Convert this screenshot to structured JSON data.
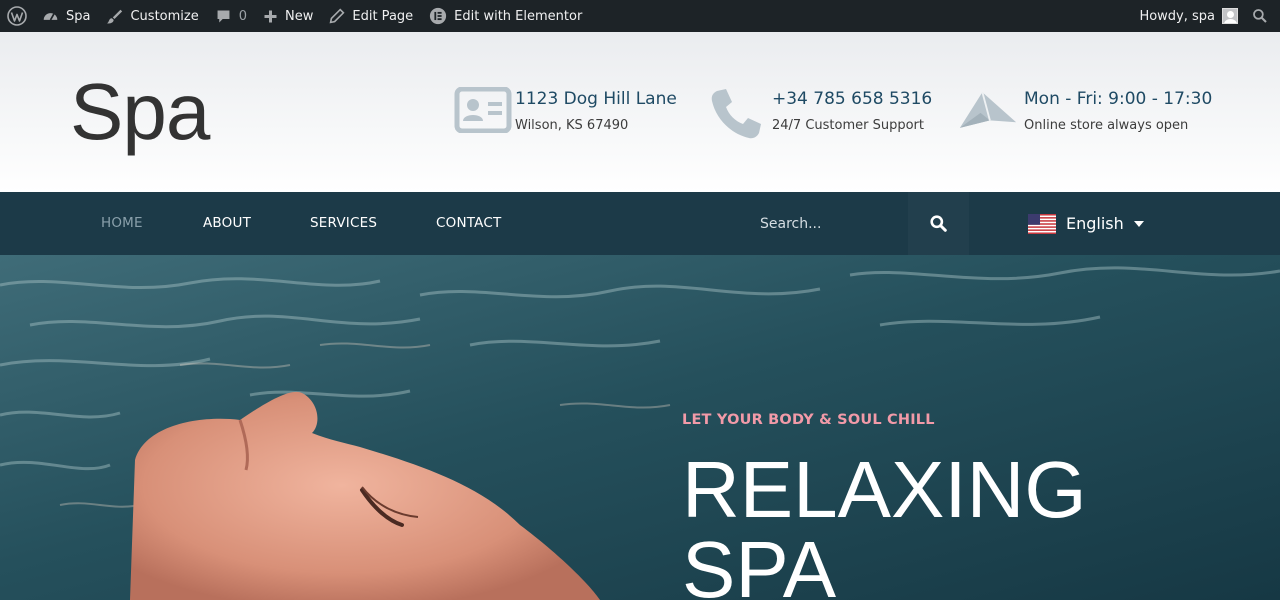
{
  "admin_bar": {
    "site_name": "Spa",
    "customize": "Customize",
    "comments_count": "0",
    "new": "New",
    "edit_page": "Edit Page",
    "edit_elementor": "Edit with Elementor",
    "howdy": "Howdy, spa"
  },
  "header": {
    "site_title": "Spa",
    "address": {
      "line1": "1123 Dog Hill Lane",
      "line2": "Wilson, KS 67490",
      "icon": "id-card-icon"
    },
    "phone": {
      "line1": "+34 785 658 5316",
      "line2": "24/7 Customer Support",
      "icon": "phone-icon"
    },
    "hours": {
      "line1": "Mon - Fri: 9:00 - 17:30",
      "line2": "Online store always open",
      "icon": "paper-plane-icon"
    }
  },
  "nav": {
    "items": [
      {
        "label": "HOME"
      },
      {
        "label": "ABOUT"
      },
      {
        "label": "SERVICES"
      },
      {
        "label": "CONTACT"
      }
    ],
    "search_placeholder": "Search...",
    "language": "English"
  },
  "hero": {
    "tagline": "LET YOUR BODY & SOUL CHILL",
    "headline_line1": "RELAXING",
    "headline_line2": "SPA"
  },
  "colors": {
    "admin_bar": "#1d2327",
    "nav_bg": "#1c3a48",
    "accent_pink": "#f29aa8",
    "text_blue": "#1f4a64"
  }
}
